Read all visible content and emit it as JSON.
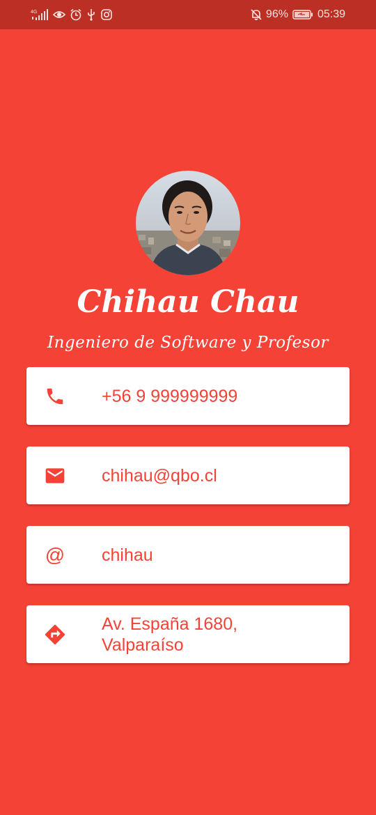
{
  "status_bar": {
    "network": "4G",
    "battery": "96%",
    "time": "05:39"
  },
  "profile": {
    "name": "Chihau Chau",
    "title": "Ingeniero de Software y Profesor"
  },
  "contacts": [
    {
      "icon": "phone-icon",
      "value": "+56 9 999999999"
    },
    {
      "icon": "email-icon",
      "value": "chihau@qbo.cl"
    },
    {
      "icon_text": "@",
      "icon": "at-icon",
      "value": "chihau"
    },
    {
      "icon": "directions-icon",
      "value_line1": "Av. España 1680,",
      "value_line2": "Valparaíso"
    }
  ],
  "colors": {
    "background": "#f44336",
    "status_bar": "#bb2f24",
    "card": "#ffffff",
    "accent": "#f44336"
  }
}
